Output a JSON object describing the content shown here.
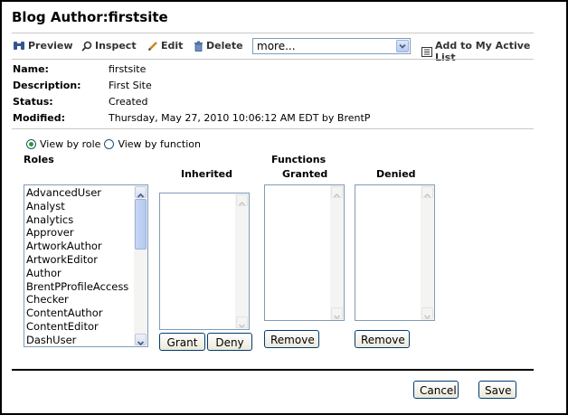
{
  "title": "Blog Author:firstsite",
  "toolbar": {
    "preview": "Preview",
    "inspect": "Inspect",
    "edit": "Edit",
    "delete": "Delete",
    "more_value": "more...",
    "add_active": "Add to My Active List"
  },
  "properties": [
    {
      "label": "Name:",
      "value": "firstsite"
    },
    {
      "label": "Description:",
      "value": "First Site"
    },
    {
      "label": "Status:",
      "value": "Created"
    },
    {
      "label": "Modified:",
      "value": "Thursday, May 27, 2010 10:06:12 AM EDT by BrentP"
    }
  ],
  "view": {
    "by_role": "View by role",
    "by_function": "View by function",
    "selected": "role"
  },
  "roles": {
    "header": "Roles",
    "items": [
      "AdvancedUser",
      "Analyst",
      "Analytics",
      "Approver",
      "ArtworkAuthor",
      "ArtworkEditor",
      "Author",
      "BrentPProfileAccess",
      "Checker",
      "ContentAuthor",
      "ContentEditor",
      "DashUser"
    ]
  },
  "functions": {
    "header": "Functions",
    "inherited": "Inherited",
    "granted": "Granted",
    "denied": "Denied",
    "grant_btn": "Grant",
    "deny_btn": "Deny",
    "remove_granted_btn": "Remove",
    "remove_denied_btn": "Remove"
  },
  "footer": {
    "cancel": "Cancel",
    "save": "Save"
  }
}
